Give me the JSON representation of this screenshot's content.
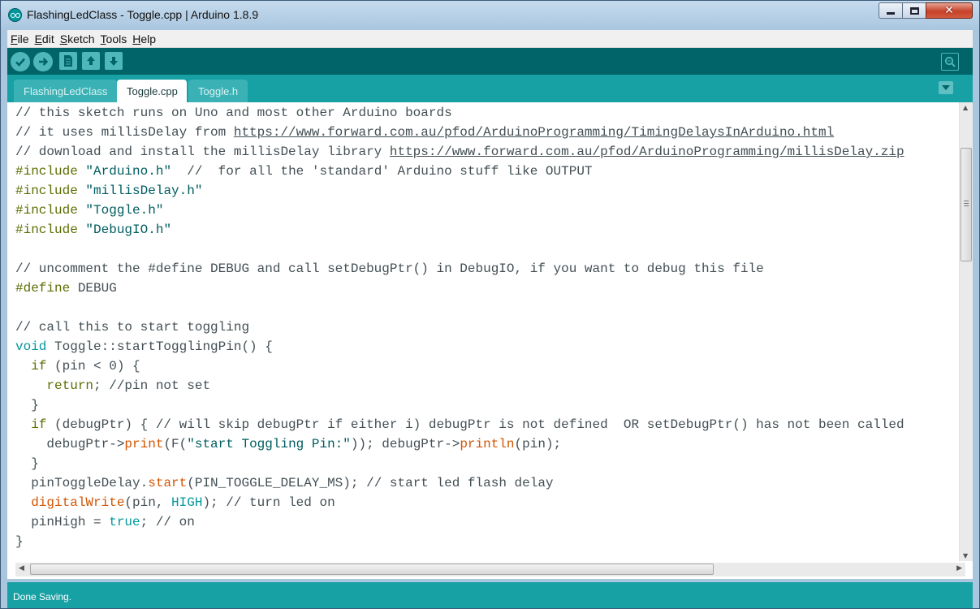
{
  "window": {
    "title": "FlashingLedClass - Toggle.cpp | Arduino 1.8.9"
  },
  "menu": {
    "items": [
      {
        "underline": "F",
        "rest": "ile"
      },
      {
        "underline": "E",
        "rest": "dit"
      },
      {
        "underline": "S",
        "rest": "ketch"
      },
      {
        "underline": "T",
        "rest": "ools"
      },
      {
        "underline": "H",
        "rest": "elp"
      }
    ]
  },
  "toolbar": {
    "buttons": [
      "verify-icon",
      "upload-icon",
      "new-icon",
      "open-icon",
      "save-icon",
      "serial-monitor-icon"
    ]
  },
  "tabs": [
    {
      "label": "FlashingLedClass",
      "active": false
    },
    {
      "label": "Toggle.cpp",
      "active": true
    },
    {
      "label": "Toggle.h",
      "active": false
    }
  ],
  "code": {
    "lines": [
      [
        [
          "cm",
          "// this sketch runs on Uno and most other Arduino boards"
        ]
      ],
      [
        [
          "cm",
          "// it uses millisDelay from "
        ],
        [
          "url",
          "https://www.forward.com.au/pfod/ArduinoProgramming/TimingDelaysInArduino.html"
        ]
      ],
      [
        [
          "cm",
          "// download and install the millisDelay library "
        ],
        [
          "url",
          "https://www.forward.com.au/pfod/ArduinoProgramming/millisDelay.zip"
        ]
      ],
      [
        [
          "pp",
          "#include"
        ],
        [
          "",
          " "
        ],
        [
          "st",
          "\"Arduino.h\""
        ],
        [
          "cm",
          "  //  for all the 'standard' Arduino stuff like OUTPUT"
        ]
      ],
      [
        [
          "pp",
          "#include"
        ],
        [
          "",
          " "
        ],
        [
          "st",
          "\"millisDelay.h\""
        ]
      ],
      [
        [
          "pp",
          "#include"
        ],
        [
          "",
          " "
        ],
        [
          "st",
          "\"Toggle.h\""
        ]
      ],
      [
        [
          "pp",
          "#include"
        ],
        [
          "",
          " "
        ],
        [
          "st",
          "\"DebugIO.h\""
        ]
      ],
      [
        [
          "",
          ""
        ]
      ],
      [
        [
          "cm",
          "// uncomment the #define DEBUG and call setDebugPtr() in DebugIO, if you want to debug this file"
        ]
      ],
      [
        [
          "pp",
          "#define"
        ],
        [
          "",
          " DEBUG"
        ]
      ],
      [
        [
          "",
          ""
        ]
      ],
      [
        [
          "cm",
          "// call this to start toggling"
        ]
      ],
      [
        [
          "kw",
          "void"
        ],
        [
          "",
          " Toggle::startTogglingPin() {"
        ]
      ],
      [
        [
          "",
          "  "
        ],
        [
          "pp",
          "if"
        ],
        [
          "",
          " (pin < 0) {"
        ]
      ],
      [
        [
          "",
          "    "
        ],
        [
          "pp",
          "return"
        ],
        [
          "",
          "; "
        ],
        [
          "cm",
          "//pin not set"
        ]
      ],
      [
        [
          "",
          "  }"
        ]
      ],
      [
        [
          "",
          "  "
        ],
        [
          "pp",
          "if"
        ],
        [
          "",
          " (debugPtr) { "
        ],
        [
          "cm",
          "// will skip debugPtr if either i) debugPtr is not defined  OR setDebugPtr() has not been called"
        ]
      ],
      [
        [
          "",
          "    debugPtr->"
        ],
        [
          "fn",
          "print"
        ],
        [
          "",
          "(F("
        ],
        [
          "st",
          "\"start Toggling Pin:\""
        ],
        [
          "",
          ")); debugPtr->"
        ],
        [
          "fn",
          "println"
        ],
        [
          "",
          "(pin);"
        ]
      ],
      [
        [
          "",
          "  }"
        ]
      ],
      [
        [
          "",
          "  pinToggleDelay."
        ],
        [
          "fn",
          "start"
        ],
        [
          "",
          "(PIN_TOGGLE_DELAY_MS); "
        ],
        [
          "cm",
          "// start led flash delay"
        ]
      ],
      [
        [
          "",
          "  "
        ],
        [
          "fn",
          "digitalWrite"
        ],
        [
          "",
          "(pin, "
        ],
        [
          "kw",
          "HIGH"
        ],
        [
          "",
          "); "
        ],
        [
          "cm",
          "// turn led on"
        ]
      ],
      [
        [
          "",
          "  pinHigh = "
        ],
        [
          "kw",
          "true"
        ],
        [
          "",
          "; "
        ],
        [
          "cm",
          "// on"
        ]
      ],
      [
        [
          "",
          "}"
        ]
      ]
    ]
  },
  "status": {
    "message": "Done Saving."
  },
  "colors": {
    "toolbar": "#006468",
    "tabbar": "#17a1a5",
    "keyword": "#00979c",
    "function": "#d35400",
    "preprocessor": "#5e6d03",
    "string": "#005c5f"
  }
}
